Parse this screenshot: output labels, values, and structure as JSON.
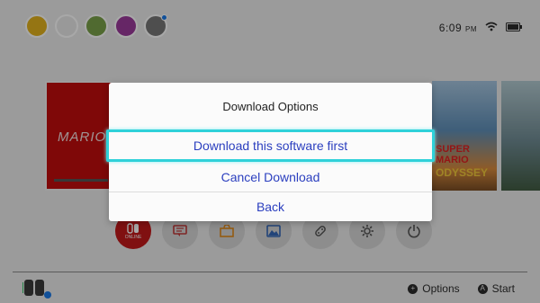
{
  "status": {
    "time": "6:09",
    "ampm": "PM"
  },
  "avatars": [
    {
      "color": "#e3b21d",
      "name": "player-1"
    },
    {
      "color": "#e9e9e9",
      "name": "player-2"
    },
    {
      "color": "#7aa14a",
      "name": "player-3"
    },
    {
      "color": "#9c3a9b",
      "name": "player-4"
    },
    {
      "color": "#777777",
      "name": "player-5"
    }
  ],
  "tiles": {
    "mario_logo": "MARIO",
    "odyssey_brand": "SUPER MARIO",
    "odyssey_sub": "ODYSSEY"
  },
  "apps": {
    "online_label": "ONLINE"
  },
  "dialog": {
    "title": "Download Options",
    "options": [
      "Download this software first",
      "Cancel Download",
      "Back"
    ]
  },
  "hints": {
    "options": "Options",
    "start": "Start",
    "options_glyph": "+",
    "start_glyph": "A"
  },
  "colors": {
    "accent": "#2fd1d9",
    "option_text": "#2b3fbf",
    "online_red": "#c3191a"
  }
}
